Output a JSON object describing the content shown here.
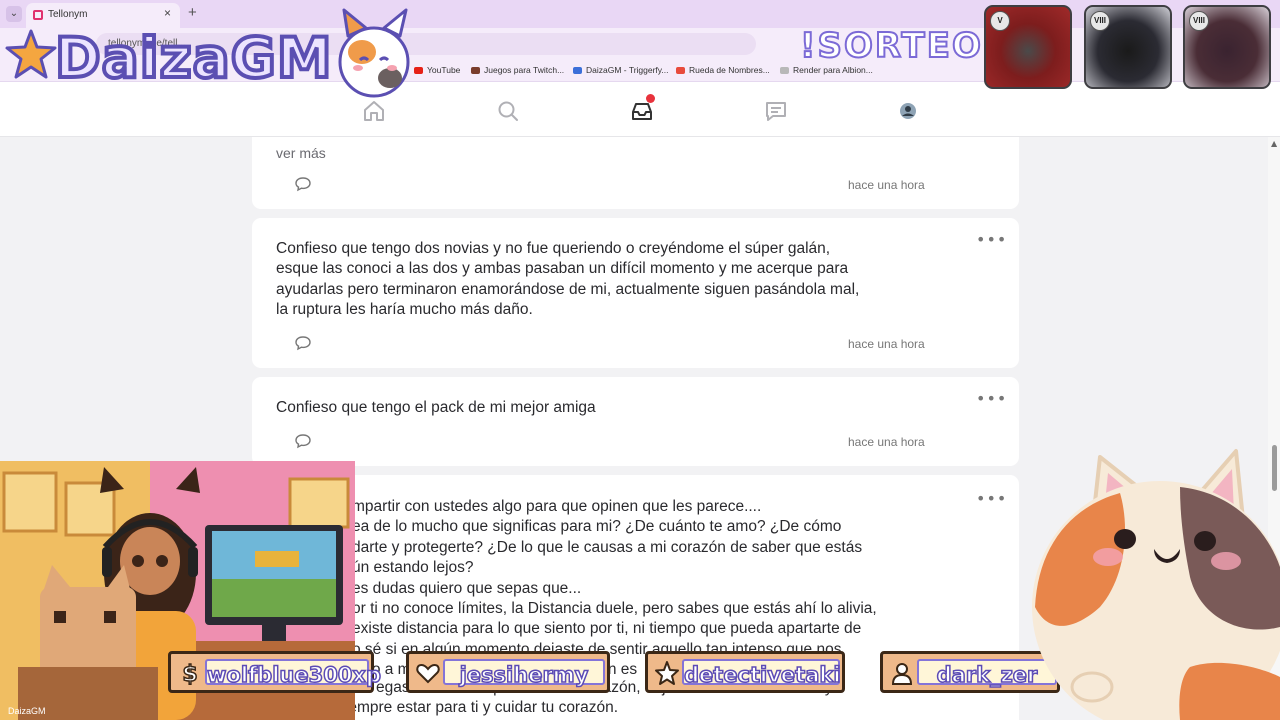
{
  "browser": {
    "tab_title": "Tellonym",
    "tab_close": "×",
    "new_tab": "+",
    "tab_menu": "⌄",
    "url": "tellonym.me/tell...",
    "bookmarks": [
      {
        "label": "YouTube",
        "color": "#e62117"
      },
      {
        "label": "Juegos para Twitch...",
        "color": "#7a3d2c"
      },
      {
        "label": "DaizaGM - Triggerfy...",
        "color": "#3b6fd9"
      },
      {
        "label": "Rueda de Nombres...",
        "color": "#e84b3c"
      },
      {
        "label": "Render para Albion...",
        "color": "#b8b8b8"
      }
    ]
  },
  "app": {
    "nav": [
      "home-icon",
      "search-icon",
      "inbox-icon",
      "chat-icon",
      "profile-avatar"
    ],
    "notification_color": "#e8323c"
  },
  "feed": {
    "partial_post": {
      "ver_mas": "ver más",
      "time": "hace una hora"
    },
    "posts": [
      {
        "lines": [
          "Confieso que tengo dos novias y no fue queriendo o creyéndome el súper galán,",
          "esque las conoci a las dos y ambas pasaban un difícil momento y me acerque para",
          "ayudarlas pero terminaron enamorándose de mi, actualmente siguen pasándola mal,",
          "la ruptura les haría mucho más daño."
        ],
        "time": "hace una hora"
      },
      {
        "lines": [
          "Confieso que tengo el pack de mi mejor amiga"
        ],
        "time": "hace una hora"
      },
      {
        "lines": [
          "mpartir con ustedes algo para que opinen que les parece....",
          "ea de lo mucho que significas para mi? ¿De cuánto te amo? ¿De cómo",
          "darte y protegerte? ¿De lo que le causas a mi corazón de saber que estás",
          "ún estando lejos?",
          "es dudas quiero que sepas que...",
          "or ti no conoce límites, la Distancia duele, pero sabes que estás ahí lo alivia,",
          "existe distancia para lo que siento por ti, ni tiempo que pueda apartarte de",
          "o sé si en algún momento dejaste de sentir aquello tan intenso que nos",
          "solo a mí, mi vida eres tú y mi corazón es",
          "egaste a mi vida para darle una razón, déjaste huella en mi alma y",
          "prometo siempre estar para ti y cuidar tu corazón."
        ],
        "more": "•••"
      }
    ],
    "more": "•••"
  },
  "overlay": {
    "logo_text": "DaizaGM",
    "raffle_text": "!SORTEO",
    "items": [
      {
        "tier": "V",
        "color": "#7d1d1d"
      },
      {
        "tier": "VIII",
        "color": "#2b2b33"
      },
      {
        "tier": "VIII",
        "color": "#4a2d36"
      }
    ],
    "webcam_tag": "DaizaGM",
    "subscribers": [
      {
        "name": "wolfblue300xp",
        "icon": "dollar-icon"
      },
      {
        "name": "jessihermy",
        "icon": "heart-icon"
      },
      {
        "name": "detectivetaki",
        "icon": "star-icon"
      },
      {
        "name": "dark_zer",
        "icon": "person-icon"
      }
    ]
  }
}
